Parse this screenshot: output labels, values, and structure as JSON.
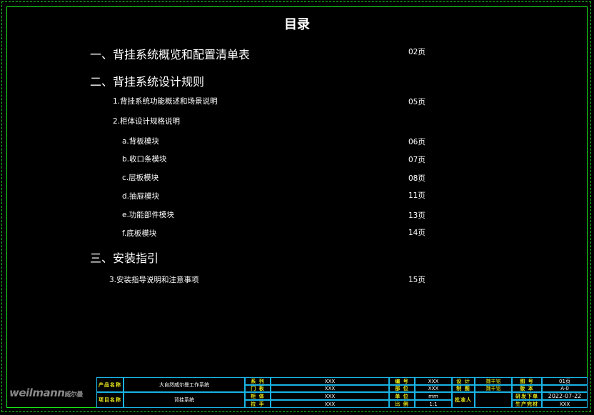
{
  "title": "目录",
  "sections": [
    {
      "label": "一、背挂系统概览和配置清单表",
      "page": "02页"
    },
    {
      "label": "二、背挂系统设计规则",
      "page": ""
    },
    {
      "label": "三、安装指引",
      "page": ""
    }
  ],
  "items": [
    {
      "label": "1.背挂系统功能概述和场景说明",
      "page": "05页"
    },
    {
      "label": "2.柜体设计规格说明",
      "page": ""
    },
    {
      "label": "a.背板模块",
      "page": "06页"
    },
    {
      "label": "b.收口条模块",
      "page": "07页"
    },
    {
      "label": "c.层板模块",
      "page": "08页"
    },
    {
      "label": "d.抽屉模块",
      "page": "11页"
    },
    {
      "label": "e.功能部件模块",
      "page": "13页"
    },
    {
      "label": "f.底板模块",
      "page": "14页"
    },
    {
      "label": "3.安装指导说明和注意事项",
      "page": "15页"
    }
  ],
  "title_block": {
    "logo_text": "weilmann",
    "logo_cn": "威尔曼",
    "product_name_label": "产品名称",
    "product_name": "大自然威尔曼工作系统",
    "project_name_label": "项目名称",
    "project_name": "背挂系统",
    "series_label": "系 列",
    "series": "XXX",
    "door_label": "门 板",
    "door": "XXX",
    "handle_label": "拉 手",
    "handle": "XXX",
    "finish_label": "柜 体",
    "finish": "XXX",
    "code_label": "编 号",
    "code": "XXX",
    "part_label": "部 位",
    "part": "XXX",
    "unit_label": "单 位",
    "unit": "mm",
    "scale_label": "比 例",
    "scale": "1:1",
    "design_label": "设 计",
    "design": "魏丰铭",
    "draw_label": "制 图",
    "draw": "魏丰铭",
    "approver_label": "批准人",
    "approver": "",
    "sheet_label": "图 号",
    "sheet": "01页",
    "version_label": "版 本",
    "version": "A-0",
    "issue_label": "研发下单",
    "issue_date": "2022-07-22",
    "prod_label": "生产完材",
    "prod": "XXX"
  }
}
